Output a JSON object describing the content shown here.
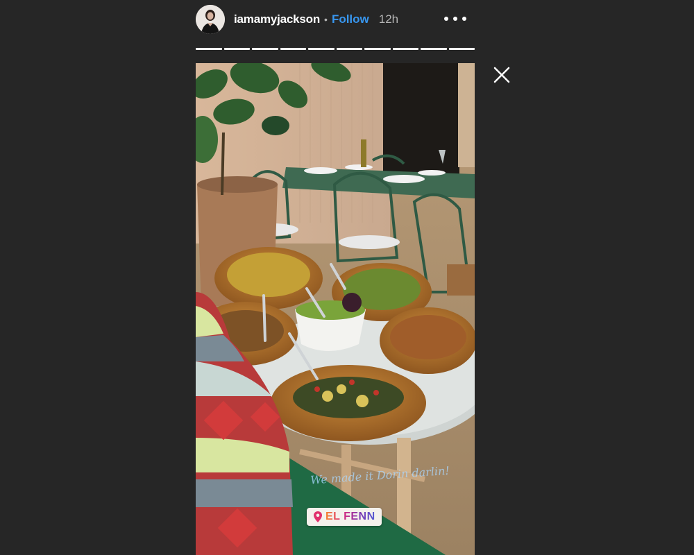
{
  "header": {
    "username": "iamamyjackson",
    "separator": "•",
    "follow_label": "Follow",
    "time_ago": "12h",
    "more_icon": "more-horizontal-icon",
    "follow_color": "#3897f0"
  },
  "progress": {
    "segments_total": 10,
    "current_segment": 10
  },
  "story": {
    "caption": "We made it Dorin darlin!",
    "location_sticker": "EL FENN",
    "location_icon": "map-pin-icon"
  },
  "close_icon": "close-x-icon"
}
